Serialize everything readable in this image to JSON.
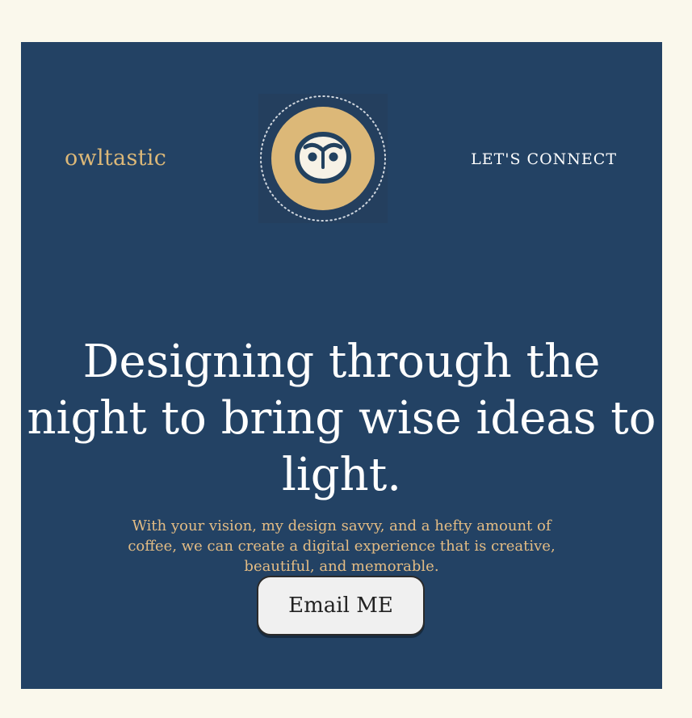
{
  "header": {
    "brand": "owltastic",
    "nav_link": "LET'S CONNECT",
    "logo_icon": "owl-icon"
  },
  "hero": {
    "headline": "Designing through the night to bring wise ideas to light.",
    "subtext": "With your vision, my design savvy, and a hefty amount of coffee, we can create a digital experience that is creative, beautiful, and memorable.",
    "cta_label": "Email ME"
  },
  "colors": {
    "page_background": "#faf8ec",
    "hero_background": "#234264",
    "accent_gold": "#dcb878",
    "text_white": "#ffffff",
    "button_background": "#f0f0f0"
  }
}
